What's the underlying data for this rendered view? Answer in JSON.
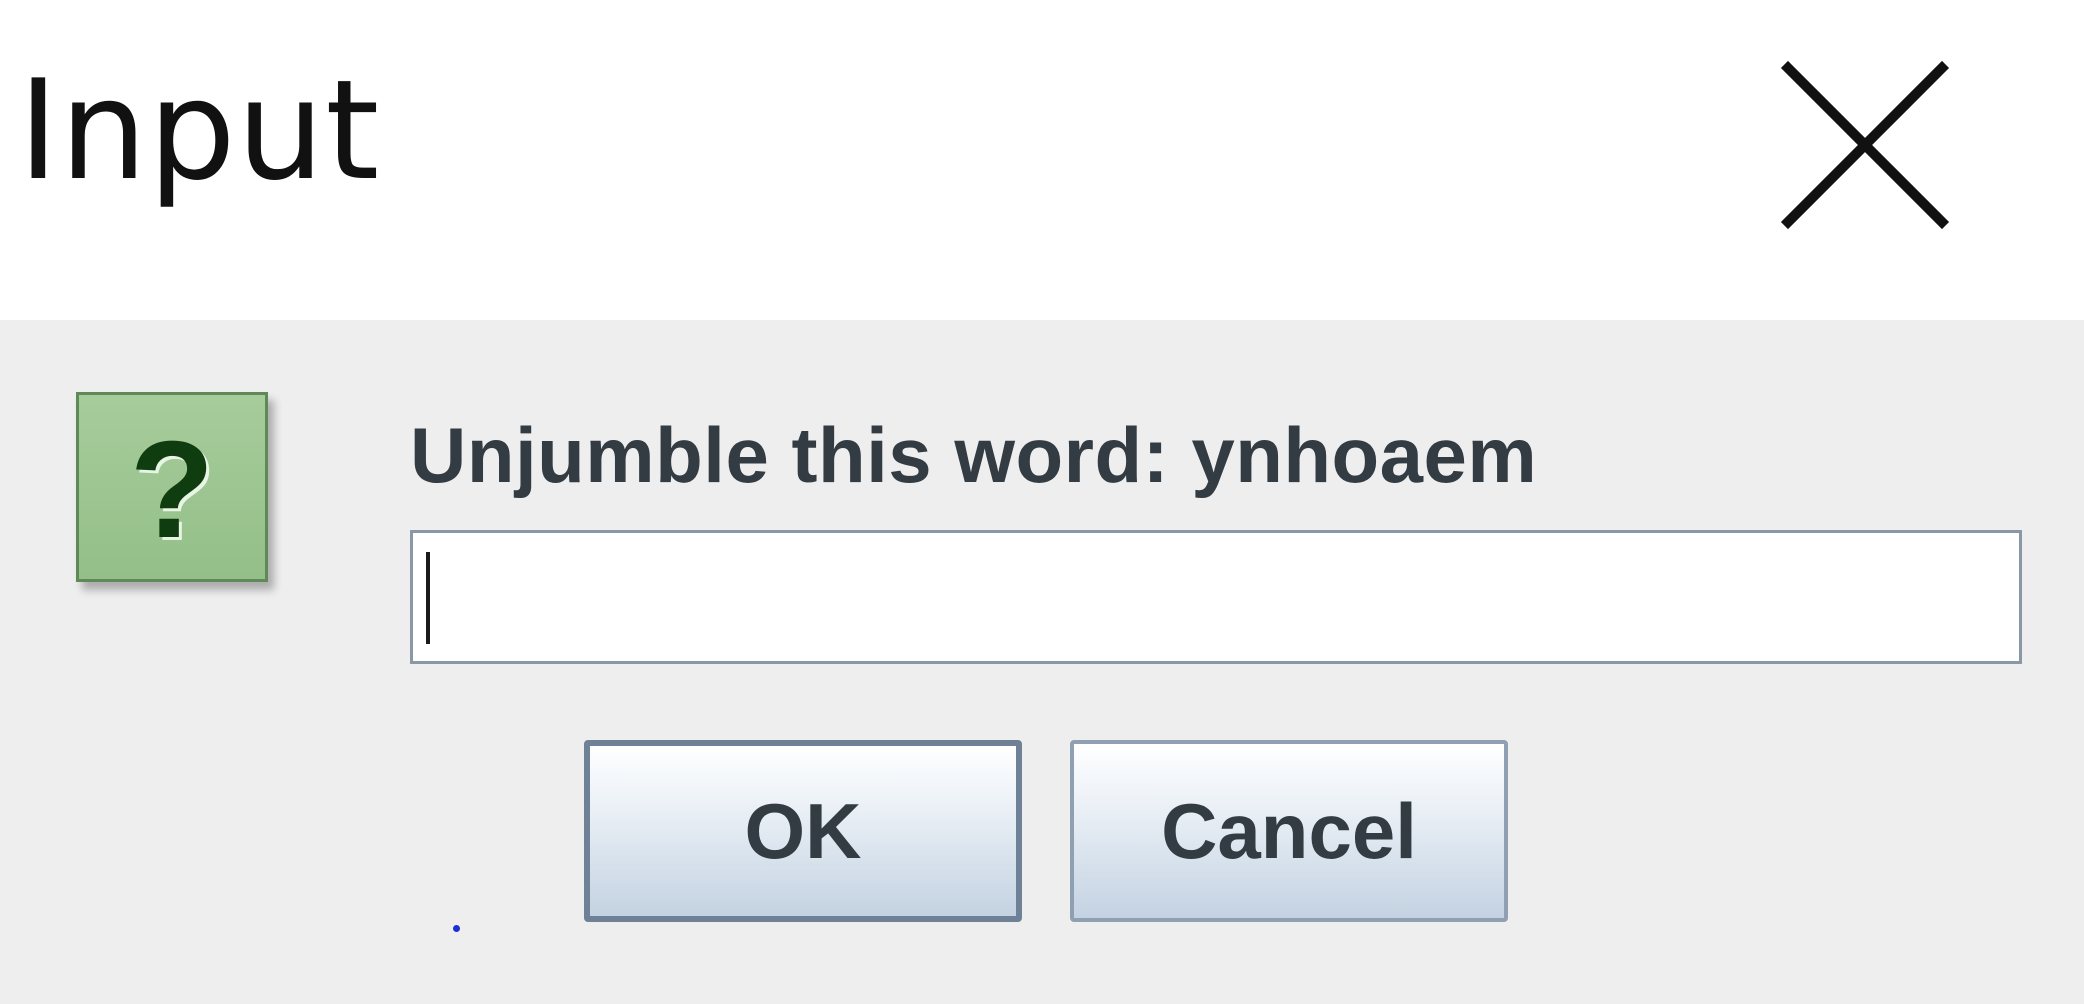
{
  "window": {
    "title": "Input",
    "close_icon": "close-icon"
  },
  "dialog": {
    "icon": "question-icon",
    "icon_glyph": "?",
    "prompt": "Unjumble this word: ynhoaem",
    "input_value": "",
    "ok_label": "OK",
    "cancel_label": "Cancel"
  },
  "colors": {
    "content_bg": "#eeeeee",
    "icon_green": "#9fc794",
    "text": "#333b43",
    "button_border": "#7e8fa2"
  }
}
